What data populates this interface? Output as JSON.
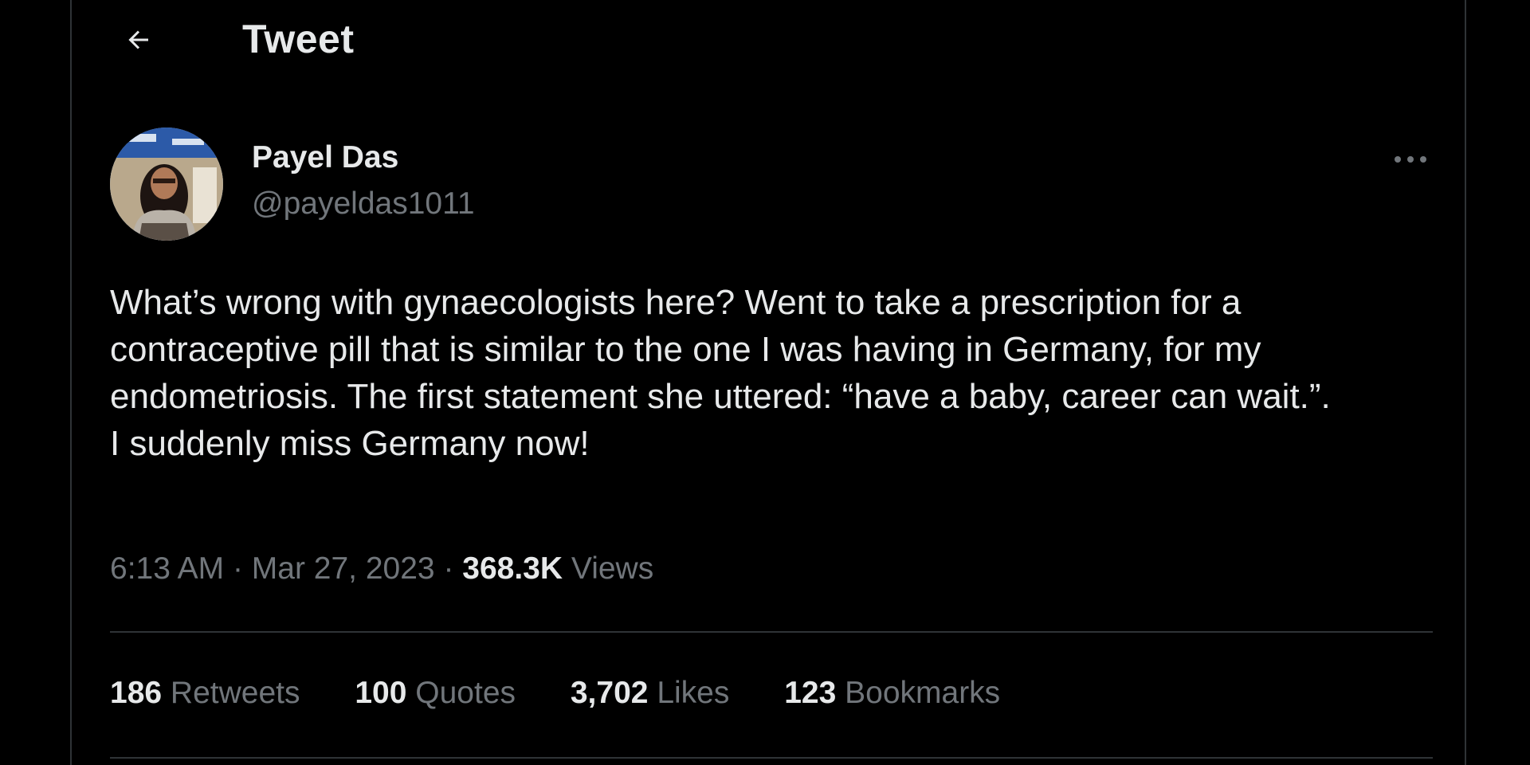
{
  "header": {
    "back_icon": "arrow-left-icon",
    "title": "Tweet"
  },
  "author": {
    "name": "Payel Das",
    "handle": "@payeldas1011",
    "more_icon": "more-horizontal-icon"
  },
  "tweet": {
    "paragraphs": [
      "What’s wrong with gynaecologists here? Went to take a prescription for a contraceptive pill that is similar to the one I was having in Germany, for my endometriosis. The first statement she uttered: “have a baby, career can wait.”.",
      "I suddenly miss Germany now!"
    ],
    "time": "6:13 AM",
    "date": "Mar 27, 2023",
    "separator": "·",
    "views_count": "368.3K",
    "views_label": "Views"
  },
  "stats": [
    {
      "count": "186",
      "label": "Retweets"
    },
    {
      "count": "100",
      "label": "Quotes"
    },
    {
      "count": "3,702",
      "label": "Likes"
    },
    {
      "count": "123",
      "label": "Bookmarks"
    }
  ],
  "colors": {
    "background": "#000000",
    "text_primary": "#e7e9ea",
    "text_secondary": "#71767b",
    "divider": "#2f3336"
  }
}
